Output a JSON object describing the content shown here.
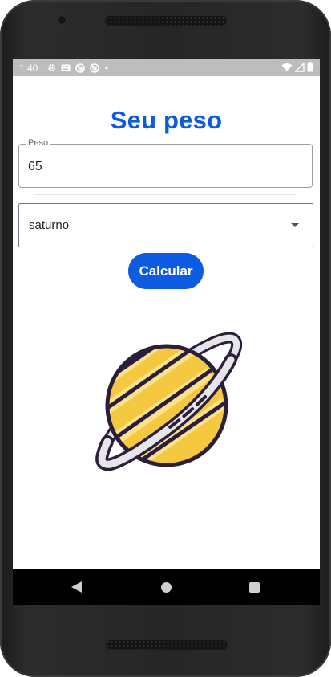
{
  "status_bar": {
    "time": "1:40",
    "left_icons": [
      "settings-icon",
      "keyboard-icon",
      "sync-icon",
      "sync-icon",
      "dot-icon"
    ],
    "right_icons": [
      "wifi-icon",
      "signal-icon",
      "battery-icon"
    ]
  },
  "app": {
    "title": "Seu peso",
    "weight_field": {
      "label": "Peso",
      "value": "65"
    },
    "planet_select": {
      "selected": "saturno"
    },
    "calculate_button": "Calcular",
    "image": "saturn-planet-illustration"
  },
  "nav_bar": {
    "buttons": [
      "back-icon",
      "home-icon",
      "recents-icon"
    ]
  },
  "colors": {
    "accent": "#0d5be1",
    "status_bar": "#bdbdbd",
    "planet_yellow": "#f5c842",
    "planet_light": "#fbe28a",
    "ring": "#e6e6ea",
    "outline": "#2b1e3a"
  }
}
